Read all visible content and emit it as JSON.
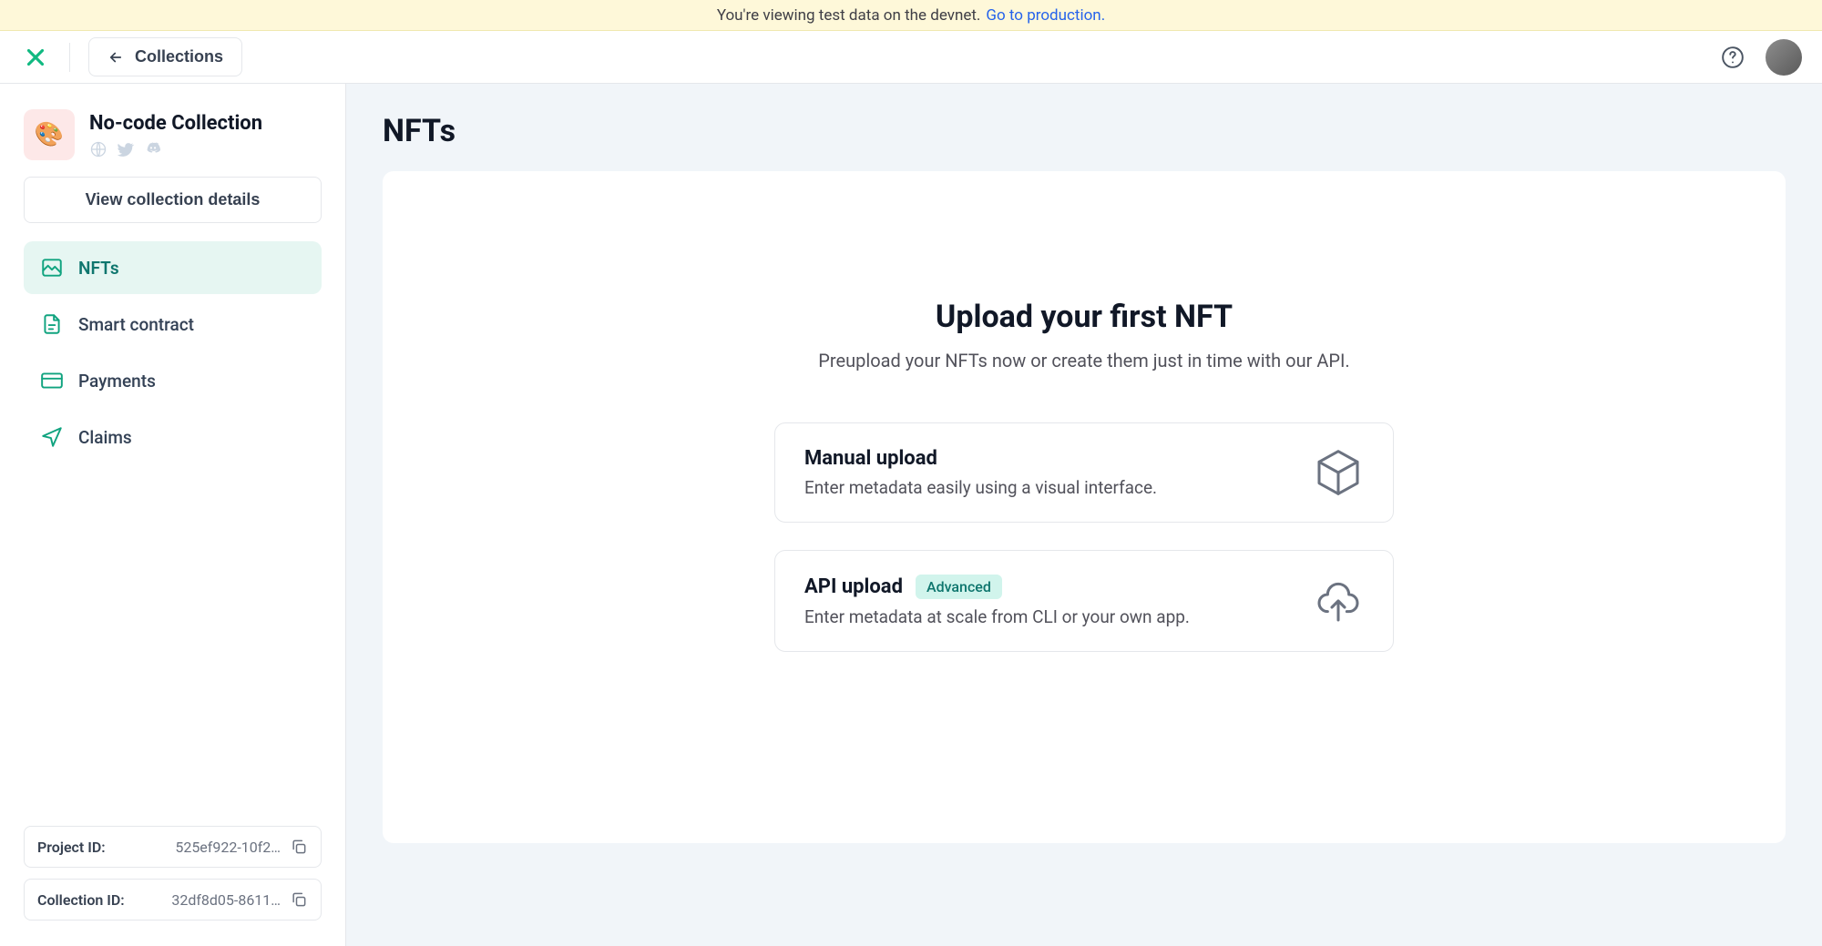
{
  "banner": {
    "text": "You're viewing test data on the devnet.",
    "link": "Go to production."
  },
  "topbar": {
    "collections_label": "Collections"
  },
  "sidebar": {
    "collection_name": "No-code Collection",
    "view_details_label": "View collection details",
    "nav": [
      {
        "label": "NFTs",
        "active": true
      },
      {
        "label": "Smart contract",
        "active": false
      },
      {
        "label": "Payments",
        "active": false
      },
      {
        "label": "Claims",
        "active": false
      }
    ],
    "project_id_label": "Project ID:",
    "project_id_value": "525ef922-10f2…",
    "collection_id_label": "Collection ID:",
    "collection_id_value": "32df8d05-8611…"
  },
  "main": {
    "page_title": "NFTs",
    "heading": "Upload your first NFT",
    "subheading": "Preupload your NFTs now or create them just in time with our API.",
    "options": {
      "manual": {
        "title": "Manual upload",
        "desc": "Enter metadata easily using a visual interface."
      },
      "api": {
        "title": "API upload",
        "badge": "Advanced",
        "desc": "Enter metadata at scale from CLI or your own app."
      }
    }
  }
}
